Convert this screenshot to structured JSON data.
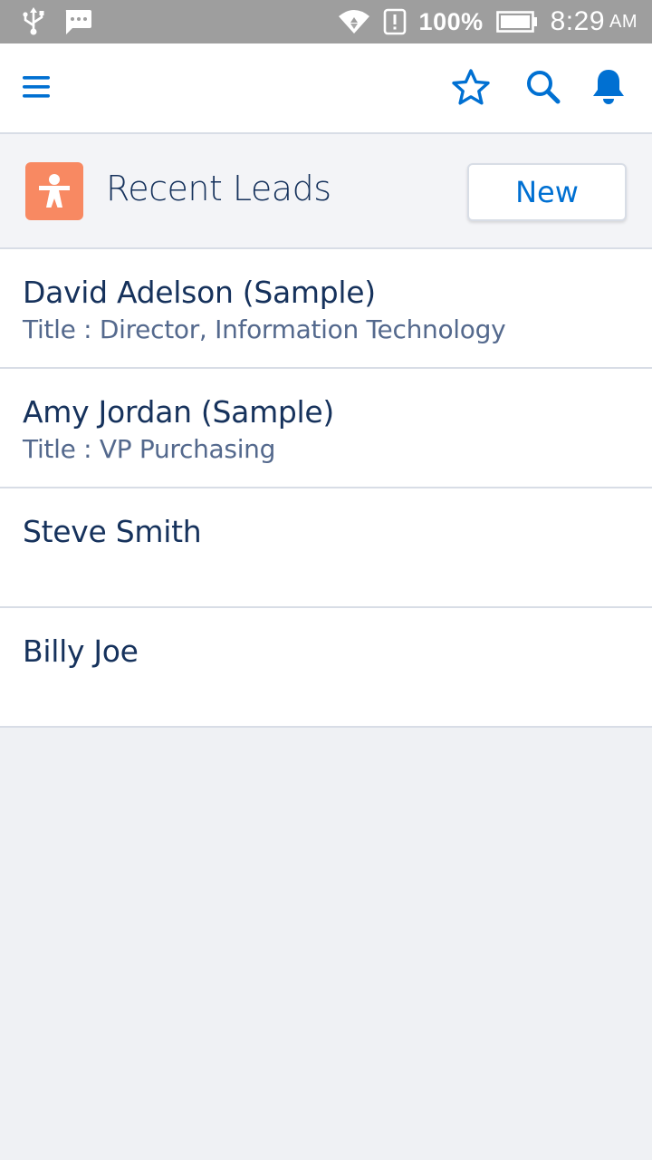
{
  "status_bar": {
    "battery": "100%",
    "time": "8:29",
    "ampm": "AM",
    "icons": [
      "usb-icon",
      "message-icon",
      "wifi-icon",
      "alert-icon",
      "battery-icon"
    ]
  },
  "header": {
    "icons": [
      "menu-icon",
      "star-icon",
      "search-icon",
      "bell-icon"
    ],
    "accent_color": "#0070d2"
  },
  "list": {
    "title": "Recent Leads",
    "new_label": "New",
    "icon": "lead-person-icon",
    "icon_color": "#f88962"
  },
  "leads": [
    {
      "name": "David Adelson (Sample)",
      "title_label": "Title : ",
      "title": "Director, Information Technology"
    },
    {
      "name": "Amy Jordan (Sample)",
      "title_label": "Title : ",
      "title": "VP Purchasing"
    },
    {
      "name": "Steve Smith",
      "title_label": "",
      "title": ""
    },
    {
      "name": "Billy Joe",
      "title_label": "",
      "title": ""
    }
  ]
}
